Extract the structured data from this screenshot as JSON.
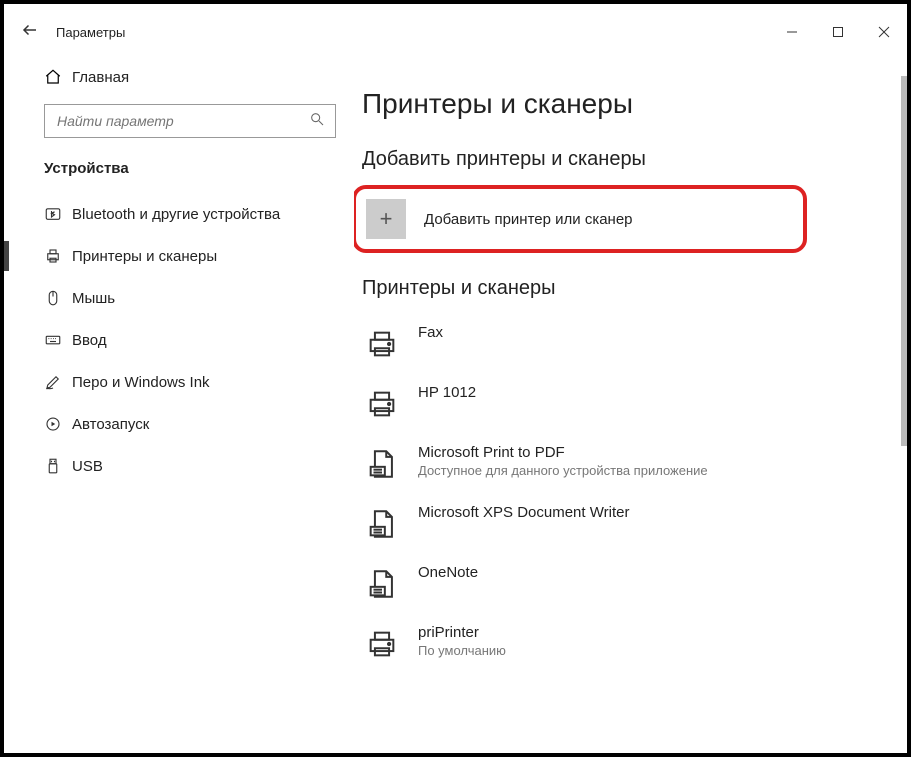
{
  "window": {
    "title": "Параметры"
  },
  "sidebar": {
    "home": "Главная",
    "search_placeholder": "Найти параметр",
    "section": "Устройства",
    "items": [
      {
        "label": "Bluetooth и другие устройства",
        "icon": "bluetooth"
      },
      {
        "label": "Принтеры и сканеры",
        "icon": "printer",
        "active": true
      },
      {
        "label": "Мышь",
        "icon": "mouse"
      },
      {
        "label": "Ввод",
        "icon": "keyboard"
      },
      {
        "label": "Перо и Windows Ink",
        "icon": "pen"
      },
      {
        "label": "Автозапуск",
        "icon": "autoplay"
      },
      {
        "label": "USB",
        "icon": "usb"
      }
    ]
  },
  "main": {
    "heading": "Принтеры и сканеры",
    "add_section": "Добавить принтеры и сканеры",
    "add_button": "Добавить принтер или сканер",
    "list_section": "Принтеры и сканеры",
    "printers": [
      {
        "name": "Fax",
        "icon": "printer",
        "sub": ""
      },
      {
        "name": "HP 1012",
        "icon": "printer",
        "sub": ""
      },
      {
        "name": "Microsoft Print to PDF",
        "icon": "virtual",
        "sub": "Доступное для данного устройства приложение"
      },
      {
        "name": "Microsoft XPS Document Writer",
        "icon": "virtual",
        "sub": ""
      },
      {
        "name": "OneNote",
        "icon": "virtual",
        "sub": ""
      },
      {
        "name": "priPrinter",
        "icon": "printer",
        "sub": "По умолчанию"
      }
    ]
  }
}
